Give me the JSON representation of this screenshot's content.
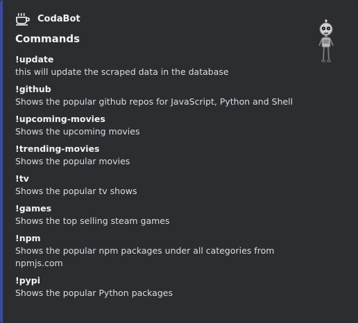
{
  "embed": {
    "accent_color": "#3b4a9e",
    "author": {
      "name": "CodaBot",
      "icon": "coffee-cup-icon"
    },
    "title": "Commands",
    "thumbnail_icon": "robot-thumbnail",
    "fields": [
      {
        "name": "!update",
        "value": "this will update the scraped data in the database"
      },
      {
        "name": "!github",
        "value": "Shows the popular github repos for JavaScript, Python and Shell"
      },
      {
        "name": "!upcoming-movies",
        "value": "Shows the upcoming movies"
      },
      {
        "name": "!trending-movies",
        "value": "Shows the popular movies"
      },
      {
        "name": "!tv",
        "value": "Shows the popular tv shows"
      },
      {
        "name": "!games",
        "value": "Shows the top selling steam games"
      },
      {
        "name": "!npm",
        "value": "Shows the popular npm packages under all categories from npmjs.com"
      },
      {
        "name": "!pypi",
        "value": "Shows the popular Python packages"
      }
    ]
  }
}
